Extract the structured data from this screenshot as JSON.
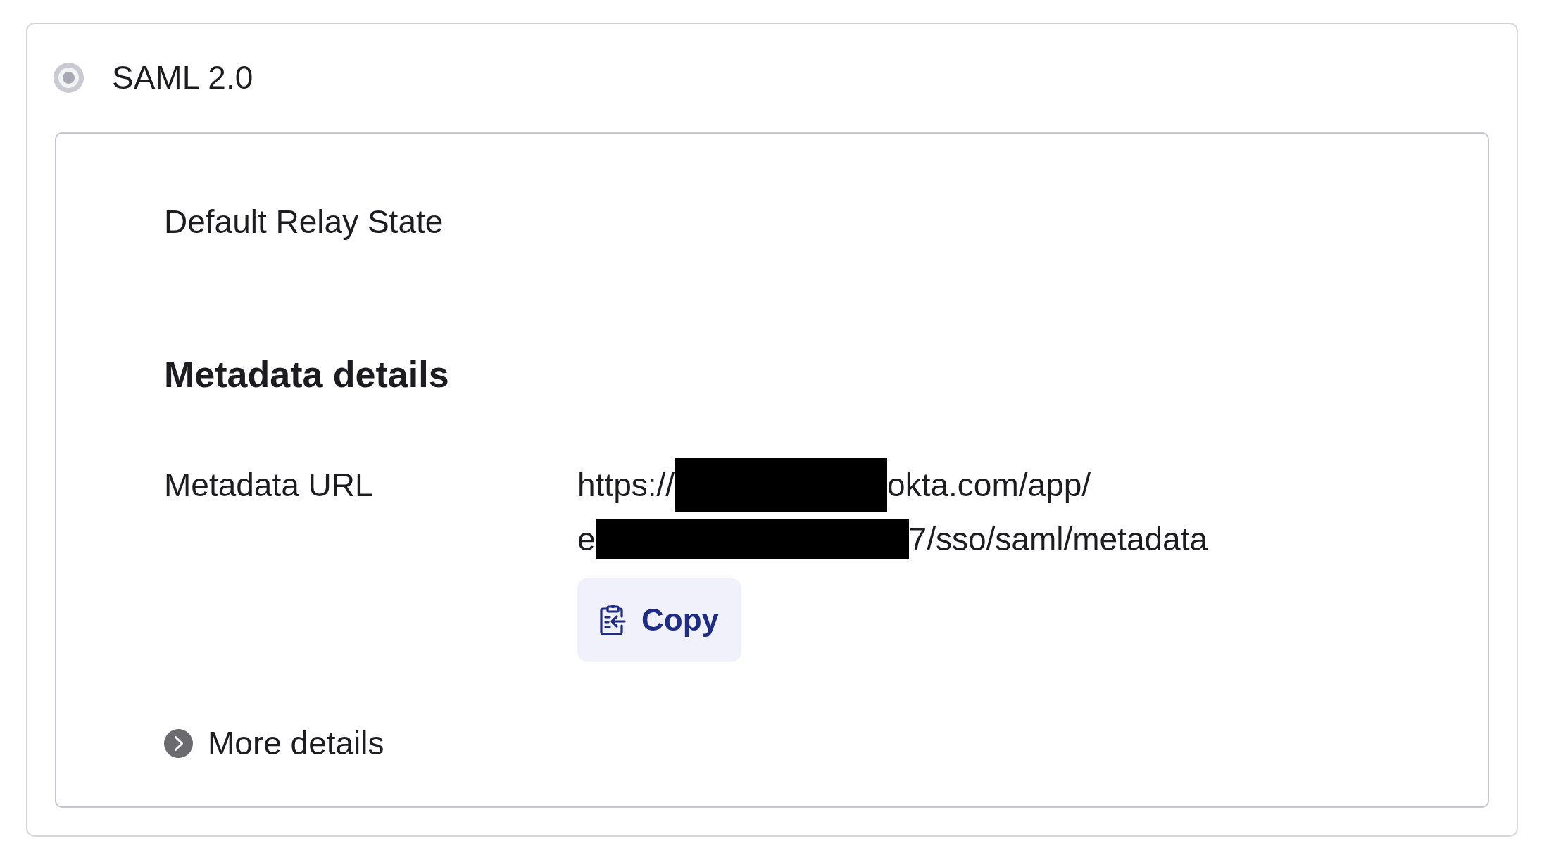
{
  "option": {
    "label": "SAML 2.0",
    "selected": true,
    "disabled": true
  },
  "relay_state": {
    "label": "Default Relay State"
  },
  "metadata": {
    "heading": "Metadata details",
    "url_label": "Metadata URL",
    "url_lines": [
      {
        "parts": [
          {
            "kind": "text",
            "text": "https://"
          },
          {
            "kind": "redacted"
          },
          {
            "kind": "text",
            "text": "okta.com/app/"
          }
        ]
      },
      {
        "parts": [
          {
            "kind": "text",
            "text": "e"
          },
          {
            "kind": "redacted"
          },
          {
            "kind": "text",
            "text": "7/sso/saml/metadata"
          }
        ]
      }
    ],
    "copy_button": {
      "label": "Copy"
    }
  },
  "more_details": {
    "label": "More details",
    "expanded": false
  }
}
